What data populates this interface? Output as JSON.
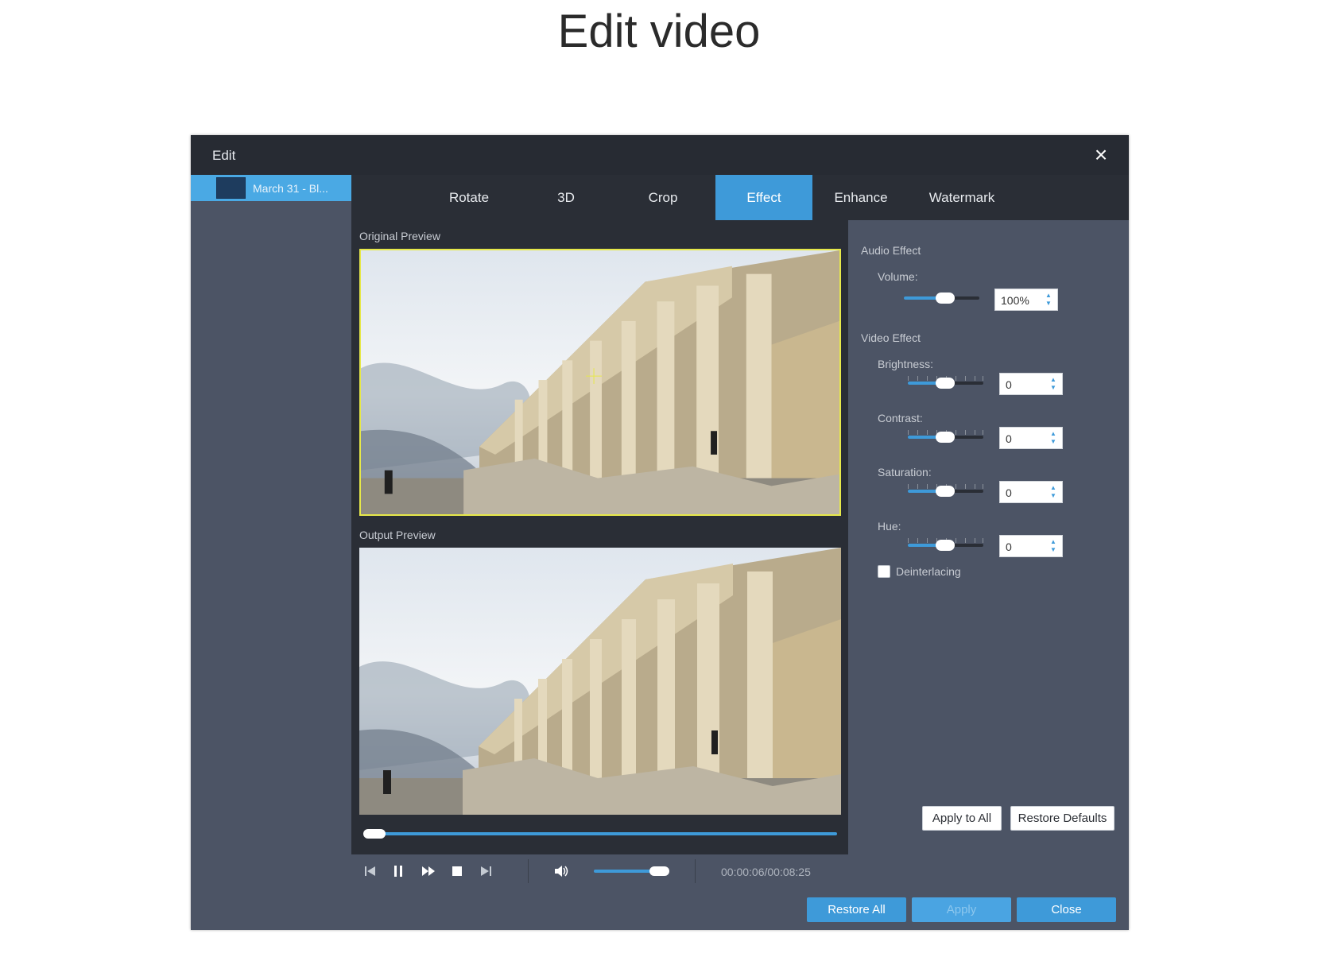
{
  "page": {
    "heading": "Edit video"
  },
  "window": {
    "title": "Edit",
    "close_icon": "×"
  },
  "sidebar": {
    "file_name": "March 31 - Bl..."
  },
  "tabs": [
    "Rotate",
    "3D",
    "Crop",
    "Effect",
    "Enhance",
    "Watermark"
  ],
  "active_tab": "Effect",
  "preview": {
    "original_label": "Original Preview",
    "output_label": "Output Preview",
    "seek_position": 0.0,
    "timecode": "00:00:06/00:08:25",
    "volume_level": 0.85
  },
  "effect": {
    "audio_title": "Audio Effect",
    "volume_label": "Volume:",
    "volume_value": "100%",
    "volume_slider": 0.55,
    "video_title": "Video Effect",
    "brightness_label": "Brightness:",
    "brightness_value": "0",
    "contrast_label": "Contrast:",
    "contrast_value": "0",
    "saturation_label": "Saturation:",
    "saturation_value": "0",
    "hue_label": "Hue:",
    "hue_value": "0",
    "deinterlacing_label": "Deinterlacing",
    "deinterlacing_checked": false,
    "apply_to_all": "Apply to All",
    "restore_defaults": "Restore Defaults"
  },
  "footer": {
    "restore_all": "Restore All",
    "apply": "Apply",
    "close": "Close"
  },
  "colors": {
    "accent": "#3e9ad9",
    "titlebar": "#272b33",
    "panel": "#4c5465",
    "dark": "#2a2e36",
    "crop_frame": "#e6e84a"
  }
}
